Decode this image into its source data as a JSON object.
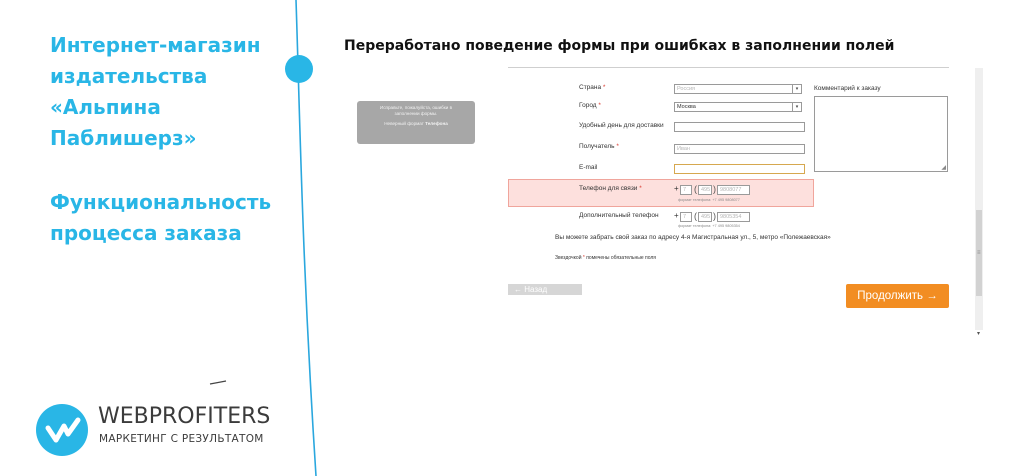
{
  "left_panel": {
    "title_lines": [
      "Интернет-магазин",
      "издательства",
      "«Альпина",
      "Паблишерз»"
    ],
    "subtitle_lines": [
      "Функциональность",
      "процесса заказа"
    ]
  },
  "logo": {
    "name": "WEBPROFITERS",
    "tagline": "МАРКЕТИНГ С РЕЗУЛЬТАТОМ"
  },
  "heading": "Переработано поведение формы при ошибках в заполнении полей",
  "tooltip": {
    "line1": "Исправьте, пожалуйста, ошибки в",
    "line1b": "заполнении формы.",
    "line2_prefix": "Неверный формат",
    "line2_bold": "Телефона"
  },
  "form": {
    "country": {
      "label": "Страна",
      "star": "*",
      "value": "Россия"
    },
    "city": {
      "label": "Город",
      "star": "*",
      "value": "Москва"
    },
    "delivery_day": {
      "label": "Удобный день для доставки",
      "value": ""
    },
    "recipient": {
      "label": "Получатель",
      "star": "*",
      "value": "Иван"
    },
    "email": {
      "label": "E-mail",
      "value": ""
    },
    "phone": {
      "label": "Телефон для связи",
      "star": "*",
      "plus": "+",
      "country_code": "7",
      "area_code": "495",
      "number": "9808077",
      "hint": "формат телефона: +7 495 9808077"
    },
    "extra_phone": {
      "label": "Дополнительный телефон",
      "plus": "+",
      "country_code": "7",
      "area_code": "495",
      "number": "9805354",
      "hint": "формат телефона: +7 495 9805354"
    },
    "comment_label": "Комментарий к заказу",
    "pickup_text": "Вы можете забрать свой заказ по адресу 4-я Магистральная ул., 5, метро «Полежаевская»",
    "required_note_star": "*",
    "required_note_prefix": "Звездочкой",
    "required_note_suffix": "помечены обязательные поля",
    "back_label": "← Назад",
    "next_label": "Продолжить →"
  },
  "colors": {
    "accent": "#29b6e6",
    "error_bg": "#fde0dd",
    "next_button": "#f28d22"
  },
  "icons": {
    "scroll_down": "▾",
    "dropdown": "▾",
    "resize": "◢"
  }
}
